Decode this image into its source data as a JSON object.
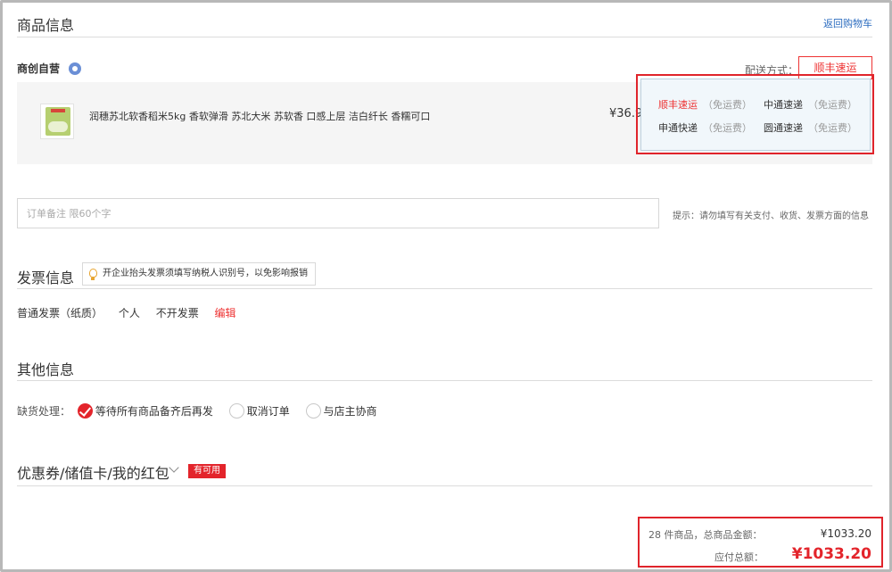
{
  "goods": {
    "title": "商品信息",
    "back_link": "返回购物车",
    "shop_name": "商创自营",
    "shipping_label": "配送方式：",
    "shipping_selected": "顺丰速运",
    "item": {
      "name": "润穗苏北软香稻米5kg 香软弹滑 苏北大米 苏软香 口感上层 洁白纤长 香糯可口",
      "price": "¥36.9"
    },
    "shipping_options": [
      {
        "name": "顺丰速运",
        "fee": "（免运费）",
        "active": true
      },
      {
        "name": "中通速递",
        "fee": "（免运费）",
        "active": false
      },
      {
        "name": "申通快递",
        "fee": "（免运费）",
        "active": false
      },
      {
        "name": "圆通速递",
        "fee": "（免运费）",
        "active": false
      }
    ]
  },
  "remark": {
    "placeholder": "订单备注 限60个字",
    "hint": "提示：请勿填写有关支付、收货、发票方面的信息"
  },
  "invoice": {
    "title": "发票信息",
    "tip": "开企业抬头发票须填写纳税人识别号，以免影响报销",
    "type": "普通发票（纸质）",
    "holder": "个人",
    "content": "不开发票",
    "edit": "编辑"
  },
  "other": {
    "title": "其他信息",
    "out_of_stock_label": "缺货处理：",
    "options": [
      {
        "label": "等待所有商品备齐后再发",
        "checked": true
      },
      {
        "label": "取消订单",
        "checked": false
      },
      {
        "label": "与店主协商",
        "checked": false
      }
    ]
  },
  "coupon": {
    "title": "优惠券/储值卡/我的红包",
    "badge": "有可用"
  },
  "totals": {
    "summary_label": "28 件商品，总商品金额：",
    "summary_value": "¥1033.20",
    "payable_label": "应付总额：",
    "payable_value": "¥1033.20"
  },
  "colors": {
    "accent_red": "#e3242b",
    "link_blue": "#2a6bbf"
  }
}
